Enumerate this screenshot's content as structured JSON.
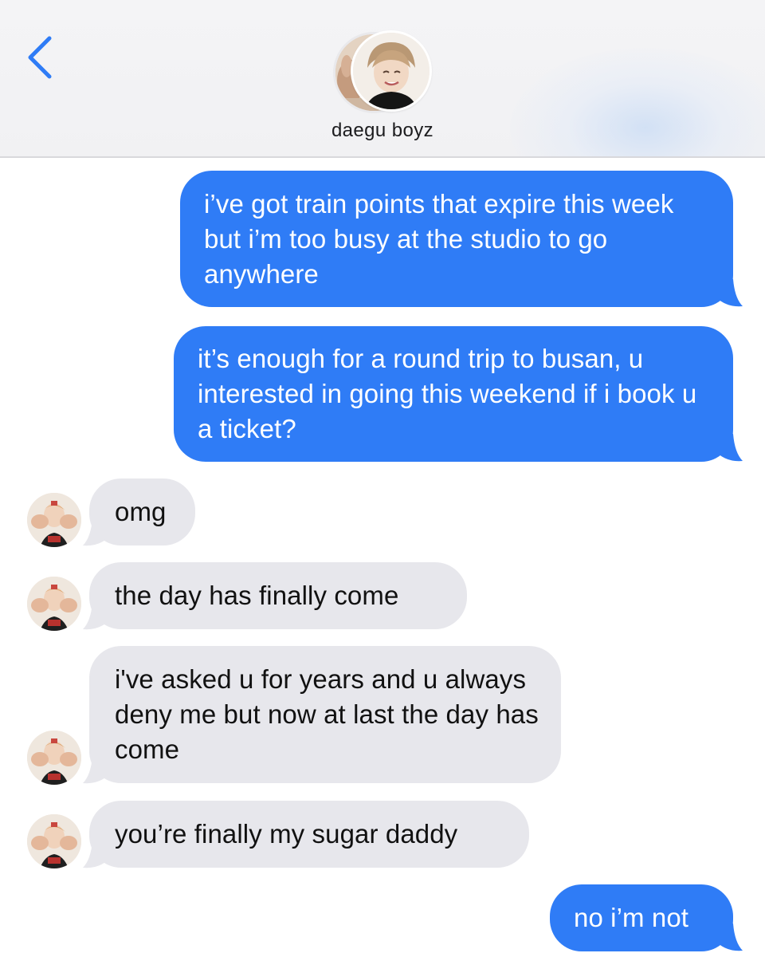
{
  "header": {
    "title": "daegu boyz",
    "back_icon": "chevron-left-icon",
    "accent_color": "#2f7cf6"
  },
  "messages": [
    {
      "direction": "sent",
      "text": "i’ve got train points that expire this week but i’m too busy at the studio to go anywhere"
    },
    {
      "direction": "sent",
      "text": "it’s enough for a round trip to busan, u interested in going this weekend if i book u a ticket?"
    },
    {
      "direction": "received",
      "text": "omg"
    },
    {
      "direction": "received",
      "text": "the day has finally come"
    },
    {
      "direction": "received",
      "text": "i've asked u for years and u always deny me but now at last the day has come"
    },
    {
      "direction": "received",
      "text": "you’re finally my sugar daddy"
    },
    {
      "direction": "sent",
      "text": "no i’m not"
    }
  ],
  "colors": {
    "sent_bubble": "#2f7cf6",
    "received_bubble": "#e7e7ec",
    "header_background": "#f2f2f4"
  }
}
